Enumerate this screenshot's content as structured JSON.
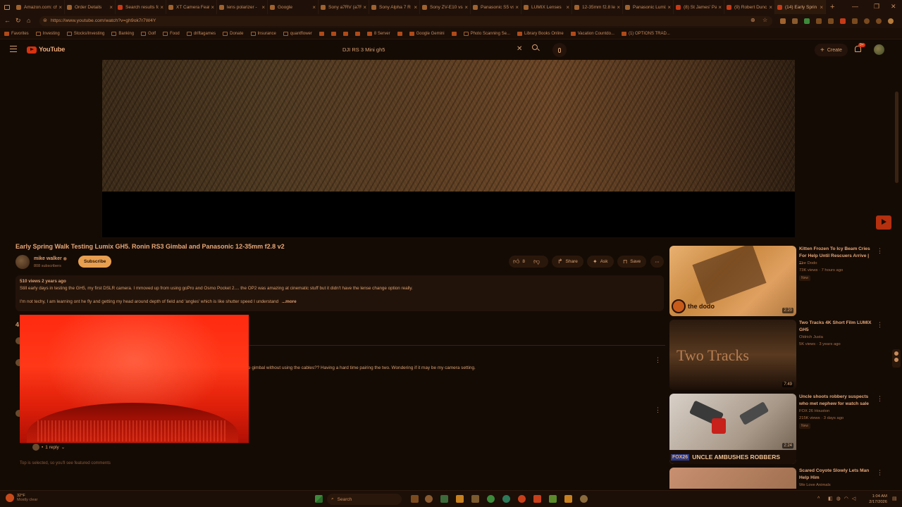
{
  "tabs": [
    {
      "title": "Amazon.com: ch",
      "favicon_color": "#a0622e"
    },
    {
      "title": "Order Details",
      "favicon_color": "#a0622e"
    },
    {
      "title": "Search results fo",
      "favicon_color": "#c73a16"
    },
    {
      "title": "XT Camera Featu",
      "favicon_color": "#a0622e"
    },
    {
      "title": "lens polarizer -",
      "favicon_color": "#a0622e"
    },
    {
      "title": "Google",
      "favicon_color": "#a0622e"
    },
    {
      "title": "Sony a7RV (a7R",
      "favicon_color": "#a0622e"
    },
    {
      "title": "Sony Alpha 7 R",
      "favicon_color": "#a0622e"
    },
    {
      "title": "Sony ZV-E10 vs",
      "favicon_color": "#a0622e"
    },
    {
      "title": "Panasonic S5 vs",
      "favicon_color": "#a0622e"
    },
    {
      "title": "LUMIX Lenses",
      "favicon_color": "#a0622e"
    },
    {
      "title": "12-35mm f2.8 le",
      "favicon_color": "#a0622e"
    },
    {
      "title": "Panasonic Lumix",
      "favicon_color": "#a0622e"
    },
    {
      "title": "(8) St James' Pa",
      "favicon_color": "#c73a16"
    },
    {
      "title": "(9) Robert Dunc",
      "favicon_color": "#c73a16"
    },
    {
      "title": "(14) Early Sprin",
      "favicon_color": "#c73a16",
      "active": true
    }
  ],
  "address": {
    "url": "https://www.youtube.com/watch?v=gh9ok7r7W4Y"
  },
  "bookmarks": [
    {
      "label": "Favorites",
      "icon": "star-icon"
    },
    {
      "label": "Investing",
      "icon": "folder-icon"
    },
    {
      "label": "Stocks/Investing",
      "icon": "folder-icon"
    },
    {
      "label": "Banking",
      "icon": "folder-icon"
    },
    {
      "label": "Golf",
      "icon": "folder-icon"
    },
    {
      "label": "Food",
      "icon": "folder-icon"
    },
    {
      "label": "driftagames",
      "icon": "folder-icon"
    },
    {
      "label": "Donate",
      "icon": "folder-icon"
    },
    {
      "label": "Insurance",
      "icon": "folder-icon"
    },
    {
      "label": "quantflower",
      "icon": "folder-icon"
    },
    {
      "label": "",
      "icon": "gmail-icon"
    },
    {
      "label": "",
      "icon": "app-icon"
    },
    {
      "label": "",
      "icon": "app-icon"
    },
    {
      "label": "",
      "icon": "app-icon"
    },
    {
      "label": "8 Server",
      "icon": "app-icon"
    },
    {
      "label": "",
      "icon": "app-icon"
    },
    {
      "label": "Google Gemini",
      "icon": "gemini-icon"
    },
    {
      "label": "",
      "icon": "app-icon"
    },
    {
      "label": "Photo Scanning Se...",
      "icon": "folder-icon"
    },
    {
      "label": "Library Books Online",
      "icon": "library-icon"
    },
    {
      "label": "Vacation Countdo...",
      "icon": "app-icon"
    },
    {
      "label": "(1) OPTIONS TRAD...",
      "icon": "youtube-icon"
    }
  ],
  "youtube": {
    "logo_text": "YouTube",
    "search_query": "DJI RS 3 Mini gh5",
    "create_label": "Create",
    "notification_count": "9+"
  },
  "video": {
    "title": "Early Spring Walk Testing Lumix GH5. Ronin RS3 Gimbal and Panasonic 12-35mm f2.8 v2",
    "channel": "mike walker",
    "subscribers": "808 subscribers",
    "subscribe_label": "Subscribe",
    "likes": "8",
    "share_label": "Share",
    "ask_label": "Ask",
    "save_label": "Save",
    "views_line": "510 views  2 years ago",
    "desc_line1": "Still early days in testing the GH5, my first DSLR camera. I mmoved up from using goPro and Osmo Pocket 2.... the OP2 was amazing at cinematic stuff but it didn't have the lense change option really.",
    "desc_line2": "I'm not techy, I am learning ont he fly and getting my head around depth of field and 'angles' which is like shutter speed I understand",
    "more_label": "...more"
  },
  "comments": {
    "count_fragment": "4",
    "comment_text_fragment": "e gimbal without using the cables?? Having a hard time pairing the two. Wondering if it may be my camera setting.",
    "reply_label": "1 reply",
    "footer_note": "Top is selected, so you'll see featured comments"
  },
  "recommendations": [
    {
      "title": "Kitten Frozen To Icy Beam Cries For Help Until Rescuers Arrive | ...",
      "channel": "The Dodo",
      "meta": "73K views · 7 hours ago",
      "badge": "New",
      "duration": "2:20",
      "thumb_text": "the dodo"
    },
    {
      "title": "Two Tracks 4K Short Film LUMIX GH5",
      "channel": "Oldrich Justa",
      "meta": "5K views · 3 years ago",
      "badge": "",
      "duration": "7:49",
      "thumb_text": "Two Tracks"
    },
    {
      "title": "Uncle shoots robbery suspects who met nephew for watch sale",
      "channel": "FOX 26 Houston",
      "meta": "215K views · 3 days ago",
      "badge": "New",
      "duration": "2:24",
      "thumb_text": "UNCLE AMBUSHES ROBBERS",
      "thumb_logo": "FOX26"
    },
    {
      "title": "Scared Coyote Slowly Lets Man Help Him",
      "channel": "We Love Animals",
      "meta": "",
      "badge": "",
      "duration": "",
      "thumb_text": ""
    }
  ],
  "taskbar": {
    "weather_temp": "32°F",
    "weather_text": "Mostly clear",
    "search_placeholder": "Search",
    "time": "1:04 AM",
    "date": "2/17/2026"
  }
}
